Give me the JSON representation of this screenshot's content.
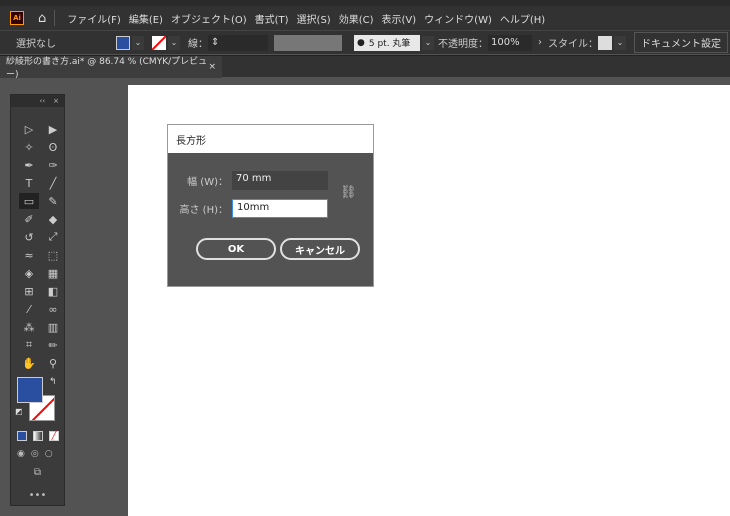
{
  "app": {
    "logo": "Ai"
  },
  "menu": [
    "ファイル(F)",
    "編集(E)",
    "オブジェクト(O)",
    "書式(T)",
    "選択(S)",
    "効果(C)",
    "表示(V)",
    "ウィンドウ(W)",
    "ヘルプ(H)"
  ],
  "control": {
    "selection": "選択なし",
    "stroke_label": "線：",
    "brush": "5 pt. 丸筆",
    "opacity_label": "不透明度：",
    "opacity": "100%",
    "style_label": "スタイル：",
    "doc_settings": "ドキュメント設定",
    "fill_color": "#2a4fa0"
  },
  "tab": {
    "title": "紗綾形の書き方.ai* @ 86.74 % (CMYK/プレビュー)",
    "close": "×"
  },
  "panel": {
    "collapse": "‹‹",
    "close": "×"
  },
  "dialog": {
    "title": "長方形",
    "width_label": "幅 (W)：",
    "width_value": "70 mm",
    "height_label": "高さ (H)：",
    "height_value": "10mm",
    "ok": "OK",
    "cancel": "キャンセル"
  }
}
